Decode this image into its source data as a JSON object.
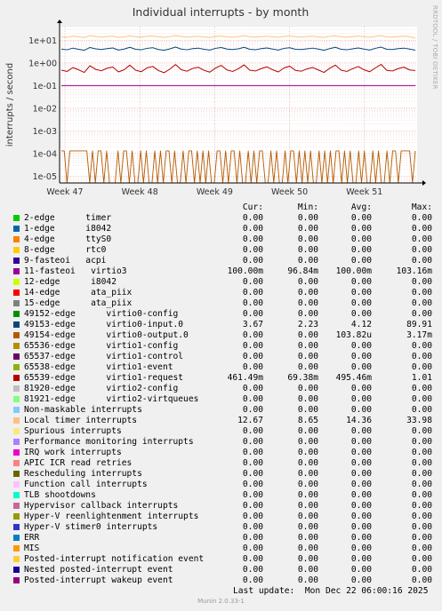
{
  "side_label": "RRDTOOL / TOBI OETIKER",
  "footer": {
    "last_update": "Last update:  Mon Dec 22 06:00:16 2025",
    "version": "Munin 2.0.33-1"
  },
  "legend_header": {
    "cur": "Cur:",
    "min": "Min:",
    "avg": "Avg:",
    "max": "Max:"
  },
  "legend": [
    {
      "name": "2-edge      timer",
      "color": "#00cc00",
      "cur": "0.00",
      "min": "0.00",
      "avg": "0.00",
      "max": "0.00"
    },
    {
      "name": "1-edge      i8042",
      "color": "#0066b3",
      "cur": "0.00",
      "min": "0.00",
      "avg": "0.00",
      "max": "0.00"
    },
    {
      "name": "4-edge      ttyS0",
      "color": "#ff8000",
      "cur": "0.00",
      "min": "0.00",
      "avg": "0.00",
      "max": "0.00"
    },
    {
      "name": "8-edge      rtc0",
      "color": "#ffcc00",
      "cur": "0.00",
      "min": "0.00",
      "avg": "0.00",
      "max": "0.00"
    },
    {
      "name": "9-fasteoi   acpi",
      "color": "#330099",
      "cur": "0.00",
      "min": "0.00",
      "avg": "0.00",
      "max": "0.00"
    },
    {
      "name": "11-fasteoi   virtio3",
      "color": "#990099",
      "cur": "100.00m",
      "min": "96.84m",
      "avg": "100.00m",
      "max": "103.16m"
    },
    {
      "name": "12-edge      i8042",
      "color": "#ccff00",
      "cur": "0.00",
      "min": "0.00",
      "avg": "0.00",
      "max": "0.00"
    },
    {
      "name": "14-edge      ata_piix",
      "color": "#ff0000",
      "cur": "0.00",
      "min": "0.00",
      "avg": "0.00",
      "max": "0.00"
    },
    {
      "name": "15-edge      ata_piix",
      "color": "#808080",
      "cur": "0.00",
      "min": "0.00",
      "avg": "0.00",
      "max": "0.00"
    },
    {
      "name": "49152-edge      virtio0-config",
      "color": "#008f00",
      "cur": "0.00",
      "min": "0.00",
      "avg": "0.00",
      "max": "0.00"
    },
    {
      "name": "49153-edge      virtio0-input.0",
      "color": "#00487d",
      "cur": "3.67",
      "min": "2.23",
      "avg": "4.12",
      "max": "89.91"
    },
    {
      "name": "49154-edge      virtio0-output.0",
      "color": "#b35a00",
      "cur": "0.00",
      "min": "0.00",
      "avg": "103.82u",
      "max": "3.17m"
    },
    {
      "name": "65536-edge      virtio1-config",
      "color": "#b38f00",
      "cur": "0.00",
      "min": "0.00",
      "avg": "0.00",
      "max": "0.00"
    },
    {
      "name": "65537-edge      virtio1-control",
      "color": "#6b006b",
      "cur": "0.00",
      "min": "0.00",
      "avg": "0.00",
      "max": "0.00"
    },
    {
      "name": "65538-edge      virtio1-event",
      "color": "#8fb300",
      "cur": "0.00",
      "min": "0.00",
      "avg": "0.00",
      "max": "0.00"
    },
    {
      "name": "65539-edge      virtio1-request",
      "color": "#b30000",
      "cur": "461.49m",
      "min": "69.38m",
      "avg": "495.46m",
      "max": "1.01"
    },
    {
      "name": "81920-edge      virtio2-config",
      "color": "#bebebe",
      "cur": "0.00",
      "min": "0.00",
      "avg": "0.00",
      "max": "0.00"
    },
    {
      "name": "81921-edge      virtio2-virtqueues",
      "color": "#80ff80",
      "cur": "0.00",
      "min": "0.00",
      "avg": "0.00",
      "max": "0.00"
    },
    {
      "name": "Non-maskable interrupts",
      "color": "#80c9ff",
      "cur": "0.00",
      "min": "0.00",
      "avg": "0.00",
      "max": "0.00"
    },
    {
      "name": "Local timer interrupts",
      "color": "#ffc080",
      "cur": "12.67",
      "min": "8.65",
      "avg": "14.36",
      "max": "33.98"
    },
    {
      "name": "Spurious interrupts",
      "color": "#ffe680",
      "cur": "0.00",
      "min": "0.00",
      "avg": "0.00",
      "max": "0.00"
    },
    {
      "name": "Performance monitoring interrupts",
      "color": "#aa80ff",
      "cur": "0.00",
      "min": "0.00",
      "avg": "0.00",
      "max": "0.00"
    },
    {
      "name": "IRQ work interrupts",
      "color": "#ee00cc",
      "cur": "0.00",
      "min": "0.00",
      "avg": "0.00",
      "max": "0.00"
    },
    {
      "name": "APIC ICR read retries",
      "color": "#ff8080",
      "cur": "0.00",
      "min": "0.00",
      "avg": "0.00",
      "max": "0.00"
    },
    {
      "name": "Rescheduling interrupts",
      "color": "#666600",
      "cur": "0.00",
      "min": "0.00",
      "avg": "0.00",
      "max": "0.00"
    },
    {
      "name": "Function call interrupts",
      "color": "#ffbfff",
      "cur": "0.00",
      "min": "0.00",
      "avg": "0.00",
      "max": "0.00"
    },
    {
      "name": "TLB shootdowns",
      "color": "#00ffcc",
      "cur": "0.00",
      "min": "0.00",
      "avg": "0.00",
      "max": "0.00"
    },
    {
      "name": "Hypervisor callback interrupts",
      "color": "#cc6699",
      "cur": "0.00",
      "min": "0.00",
      "avg": "0.00",
      "max": "0.00"
    },
    {
      "name": "Hyper-V reenlightenment interrupts",
      "color": "#999900",
      "cur": "0.00",
      "min": "0.00",
      "avg": "0.00",
      "max": "0.00"
    },
    {
      "name": "Hyper-V stimer0 interrupts",
      "color": "#3333cc",
      "cur": "0.00",
      "min": "0.00",
      "avg": "0.00",
      "max": "0.00"
    },
    {
      "name": "ERR",
      "color": "#0080c0",
      "cur": "0.00",
      "min": "0.00",
      "avg": "0.00",
      "max": "0.00"
    },
    {
      "name": "MIS",
      "color": "#ff9900",
      "cur": "0.00",
      "min": "0.00",
      "avg": "0.00",
      "max": "0.00"
    },
    {
      "name": "Posted-interrupt notification event",
      "color": "#ffcc33",
      "cur": "0.00",
      "min": "0.00",
      "avg": "0.00",
      "max": "0.00"
    },
    {
      "name": "Nested posted-interrupt event",
      "color": "#1a0099",
      "cur": "0.00",
      "min": "0.00",
      "avg": "0.00",
      "max": "0.00"
    },
    {
      "name": "Posted-interrupt wakeup event",
      "color": "#990080",
      "cur": "0.00",
      "min": "0.00",
      "avg": "0.00",
      "max": "0.00"
    }
  ],
  "chart_data": {
    "type": "line",
    "title": "Individual interrupts - by month",
    "ylabel": "interrupts / second",
    "y_scale": "log",
    "ylim": [
      5e-06,
      40
    ],
    "y_ticks": [
      {
        "value": 10,
        "label": "1e+01"
      },
      {
        "value": 1,
        "label": "1e+00"
      },
      {
        "value": 0.1,
        "label": "1e-01"
      },
      {
        "value": 0.01,
        "label": "1e-02"
      },
      {
        "value": 0.001,
        "label": "1e-03"
      },
      {
        "value": 0.0001,
        "label": "1e-04"
      },
      {
        "value": 1e-05,
        "label": "1e-05"
      }
    ],
    "x_ticks": [
      "Week 47",
      "Week 48",
      "Week 49",
      "Week 50",
      "Week 51"
    ],
    "grid": true,
    "series": [
      {
        "name": "Local timer interrupts",
        "color": "#ffc080",
        "values": [
          14.0,
          13.6,
          15.2,
          14.1,
          13.2,
          16.0,
          14.8,
          13.9,
          14.6,
          15.1,
          13.4,
          14.2,
          15.6,
          14.3,
          13.7,
          14.9,
          15.3,
          14.1,
          13.5,
          14.4,
          16.2,
          14.7,
          13.8,
          14.5,
          15.0,
          14.0,
          13.3,
          14.8,
          15.4,
          14.2,
          13.6,
          14.6,
          15.8,
          14.4,
          13.9,
          14.3,
          15.2,
          14.1,
          13.5,
          14.7,
          15.5,
          14.3,
          13.8,
          14.6,
          15.1,
          14.0,
          13.4,
          14.9,
          15.7,
          14.2,
          13.7,
          14.5,
          15.3,
          14.4,
          13.6,
          14.8,
          16.0,
          14.1,
          13.9,
          14.6,
          15.2,
          14.3,
          12.67
        ]
      },
      {
        "name": "49153-edge virtio0-input.0",
        "color": "#00487d",
        "values": [
          4.1,
          3.8,
          4.5,
          4.0,
          3.6,
          4.8,
          4.2,
          3.9,
          4.3,
          4.6,
          3.7,
          4.1,
          4.9,
          4.0,
          3.8,
          4.4,
          4.7,
          3.9,
          3.6,
          4.2,
          5.0,
          4.1,
          3.8,
          4.3,
          4.5,
          4.0,
          3.7,
          4.4,
          4.8,
          4.1,
          3.9,
          4.2,
          4.9,
          4.0,
          3.8,
          4.3,
          4.6,
          4.1,
          3.7,
          4.4,
          4.7,
          4.0,
          3.9,
          4.2,
          4.5,
          4.1,
          3.6,
          4.3,
          4.9,
          4.0,
          3.8,
          4.2,
          4.6,
          4.1,
          3.7,
          4.4,
          5.0,
          4.0,
          3.9,
          4.3,
          4.5,
          4.1,
          3.67
        ]
      },
      {
        "name": "65539-edge virtio1-request",
        "color": "#b30000",
        "values": [
          0.48,
          0.42,
          0.62,
          0.5,
          0.38,
          0.75,
          0.52,
          0.45,
          0.58,
          0.66,
          0.4,
          0.5,
          0.8,
          0.48,
          0.41,
          0.6,
          0.7,
          0.46,
          0.37,
          0.53,
          0.85,
          0.5,
          0.43,
          0.57,
          0.64,
          0.47,
          0.39,
          0.59,
          0.78,
          0.49,
          0.42,
          0.55,
          0.82,
          0.48,
          0.44,
          0.56,
          0.67,
          0.5,
          0.4,
          0.6,
          0.72,
          0.47,
          0.43,
          0.54,
          0.63,
          0.49,
          0.38,
          0.58,
          0.8,
          0.48,
          0.42,
          0.55,
          0.69,
          0.5,
          0.41,
          0.6,
          0.86,
          0.47,
          0.44,
          0.56,
          0.65,
          0.49,
          0.46
        ]
      },
      {
        "name": "11-fasteoi virtio3",
        "color": "#990099",
        "values": [
          0.1,
          0.1
        ]
      },
      {
        "name": "49154-edge virtio0-output.0",
        "color": "#b35a00",
        "values": [
          0.00013,
          0.00013,
          4e-06,
          0.00013,
          0.00013,
          0.00013,
          0.00013,
          0.00013,
          0.00013,
          0.00013,
          4e-06,
          0.00013,
          4e-06,
          0.00013,
          0.00013,
          4e-06,
          0.00013,
          4e-06,
          4e-06,
          4e-06,
          0.00013,
          4e-06,
          0.00013,
          0.00013,
          4e-06,
          0.00013,
          4e-06,
          4e-06,
          0.00013,
          4e-06,
          0.00013,
          4e-06,
          4e-06,
          0.00013,
          4e-06,
          0.00013,
          4e-06,
          0.00013,
          0.00013,
          4e-06,
          0.00013,
          4e-06,
          4e-06,
          0.00013,
          4e-06,
          0.00013,
          0.00013,
          4e-06,
          0.00013,
          4e-06,
          0.00013,
          4e-06,
          0.00013,
          4e-06,
          4e-06,
          0.00013,
          0.00013,
          4e-06,
          0.00013,
          4e-06,
          0.00013,
          0.00013,
          4e-06,
          0.00013,
          4e-06,
          4e-06,
          0.00013,
          4e-06,
          0.00013,
          4e-06,
          0.00013,
          0.00013,
          4e-06,
          4e-06,
          0.00013,
          4e-06,
          0.00013,
          4e-06,
          4e-06,
          0.00013,
          4e-06,
          0.00013,
          0.00013,
          4e-06,
          0.00013,
          4e-06,
          0.00013,
          4e-06,
          0.00013,
          4e-06,
          4e-06,
          0.00013,
          4e-06,
          0.00013,
          4e-06,
          0.00013,
          4e-06,
          0.00013,
          0.00013,
          4e-06,
          0.00013,
          4e-06,
          0.00013,
          4e-06,
          4e-06,
          0.00013,
          4e-06,
          0.00013,
          4e-06,
          4e-06,
          0.00013,
          4e-06,
          0.00013,
          4e-06,
          4e-06,
          0.00013,
          4e-06,
          0.00013,
          0.00013,
          4e-06,
          0.00013,
          0.00013,
          0.00013,
          0.00013,
          4e-06,
          0.00013
        ]
      }
    ]
  }
}
